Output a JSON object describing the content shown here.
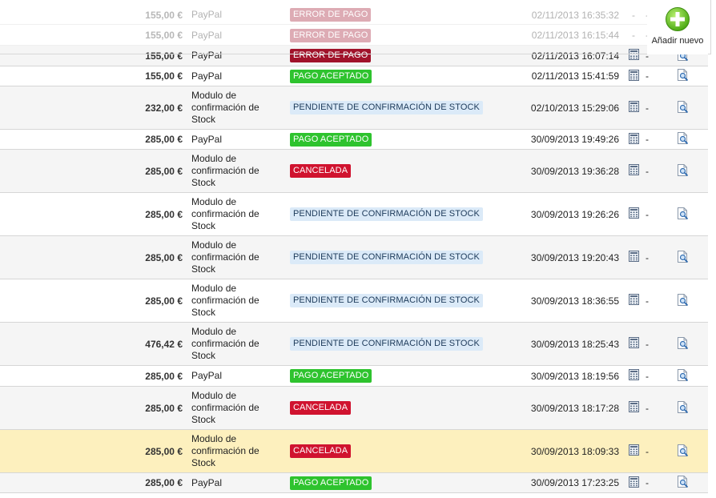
{
  "toolbar": {
    "add_new_label": "Añadir nuevo"
  },
  "colors": {
    "accepted": "#2ec32e",
    "cancelled": "#d0132f",
    "error": "#a0122a",
    "pending_bg": "#dbeaf8",
    "pending_text": "#1d3a5a",
    "highlight": "#fdf0be"
  },
  "orders": [
    {
      "total": "155,00 €",
      "payment": "PayPal",
      "status": "ERROR DE PAGO",
      "status_type": "error",
      "date": "02/11/2013 16:35:32",
      "invoice": "-",
      "dash": "-",
      "ghost": true
    },
    {
      "total": "155,00 €",
      "payment": "PayPal",
      "status": "ERROR DE PAGO",
      "status_type": "error",
      "date": "02/11/2013 16:15:44",
      "invoice": "-",
      "dash": "-",
      "ghost": true
    },
    {
      "total": "155,00 €",
      "payment": "PayPal",
      "status": "ERROR DE PAGO",
      "status_type": "error",
      "date": "02/11/2013 16:07:14",
      "invoice": "",
      "dash": "-",
      "ghost": false,
      "clipped": true
    },
    {
      "total": "155,00 €",
      "payment": "PayPal",
      "status": "PAGO ACEPTADO",
      "status_type": "accepted",
      "date": "02/11/2013 15:41:59",
      "invoice": "",
      "dash": "-"
    },
    {
      "total": "232,00 €",
      "payment": "Modulo de confirmación de Stock",
      "status": "PENDIENTE DE CONFIRMACIÓN DE STOCK",
      "status_type": "pending",
      "date": "02/10/2013 15:29:06",
      "invoice": "",
      "dash": "-"
    },
    {
      "total": "285,00 €",
      "payment": "PayPal",
      "status": "PAGO ACEPTADO",
      "status_type": "accepted",
      "date": "30/09/2013 19:49:26",
      "invoice": "",
      "dash": "-"
    },
    {
      "total": "285,00 €",
      "payment": "Modulo de confirmación de Stock",
      "status": "CANCELADA",
      "status_type": "cancelled",
      "date": "30/09/2013 19:36:28",
      "invoice": "",
      "dash": "-"
    },
    {
      "total": "285,00 €",
      "payment": "Modulo de confirmación de Stock",
      "status": "PENDIENTE DE CONFIRMACIÓN DE STOCK",
      "status_type": "pending",
      "date": "30/09/2013 19:26:26",
      "invoice": "",
      "dash": "-"
    },
    {
      "total": "285,00 €",
      "payment": "Modulo de confirmación de Stock",
      "status": "PENDIENTE DE CONFIRMACIÓN DE STOCK",
      "status_type": "pending",
      "date": "30/09/2013 19:20:43",
      "invoice": "",
      "dash": "-"
    },
    {
      "total": "285,00 €",
      "payment": "Modulo de confirmación de Stock",
      "status": "PENDIENTE DE CONFIRMACIÓN DE STOCK",
      "status_type": "pending",
      "date": "30/09/2013 18:36:55",
      "invoice": "",
      "dash": "-"
    },
    {
      "total": "476,42 €",
      "payment": "Modulo de confirmación de Stock",
      "status": "PENDIENTE DE CONFIRMACIÓN DE STOCK",
      "status_type": "pending",
      "date": "30/09/2013 18:25:43",
      "invoice": "",
      "dash": "-"
    },
    {
      "total": "285,00 €",
      "payment": "PayPal",
      "status": "PAGO ACEPTADO",
      "status_type": "accepted",
      "date": "30/09/2013 18:19:56",
      "invoice": "",
      "dash": "-"
    },
    {
      "total": "285,00 €",
      "payment": "Modulo de confirmación de Stock",
      "status": "CANCELADA",
      "status_type": "cancelled",
      "date": "30/09/2013 18:17:28",
      "invoice": "",
      "dash": "-"
    },
    {
      "total": "285,00 €",
      "payment": "Modulo de confirmación de Stock",
      "status": "CANCELADA",
      "status_type": "cancelled",
      "date": "30/09/2013 18:09:33",
      "invoice": "",
      "dash": "-",
      "highlight": true
    },
    {
      "total": "285,00 €",
      "payment": "PayPal",
      "status": "PAGO ACEPTADO",
      "status_type": "accepted",
      "date": "30/09/2013 17:23:25",
      "invoice": "",
      "dash": "-"
    }
  ]
}
